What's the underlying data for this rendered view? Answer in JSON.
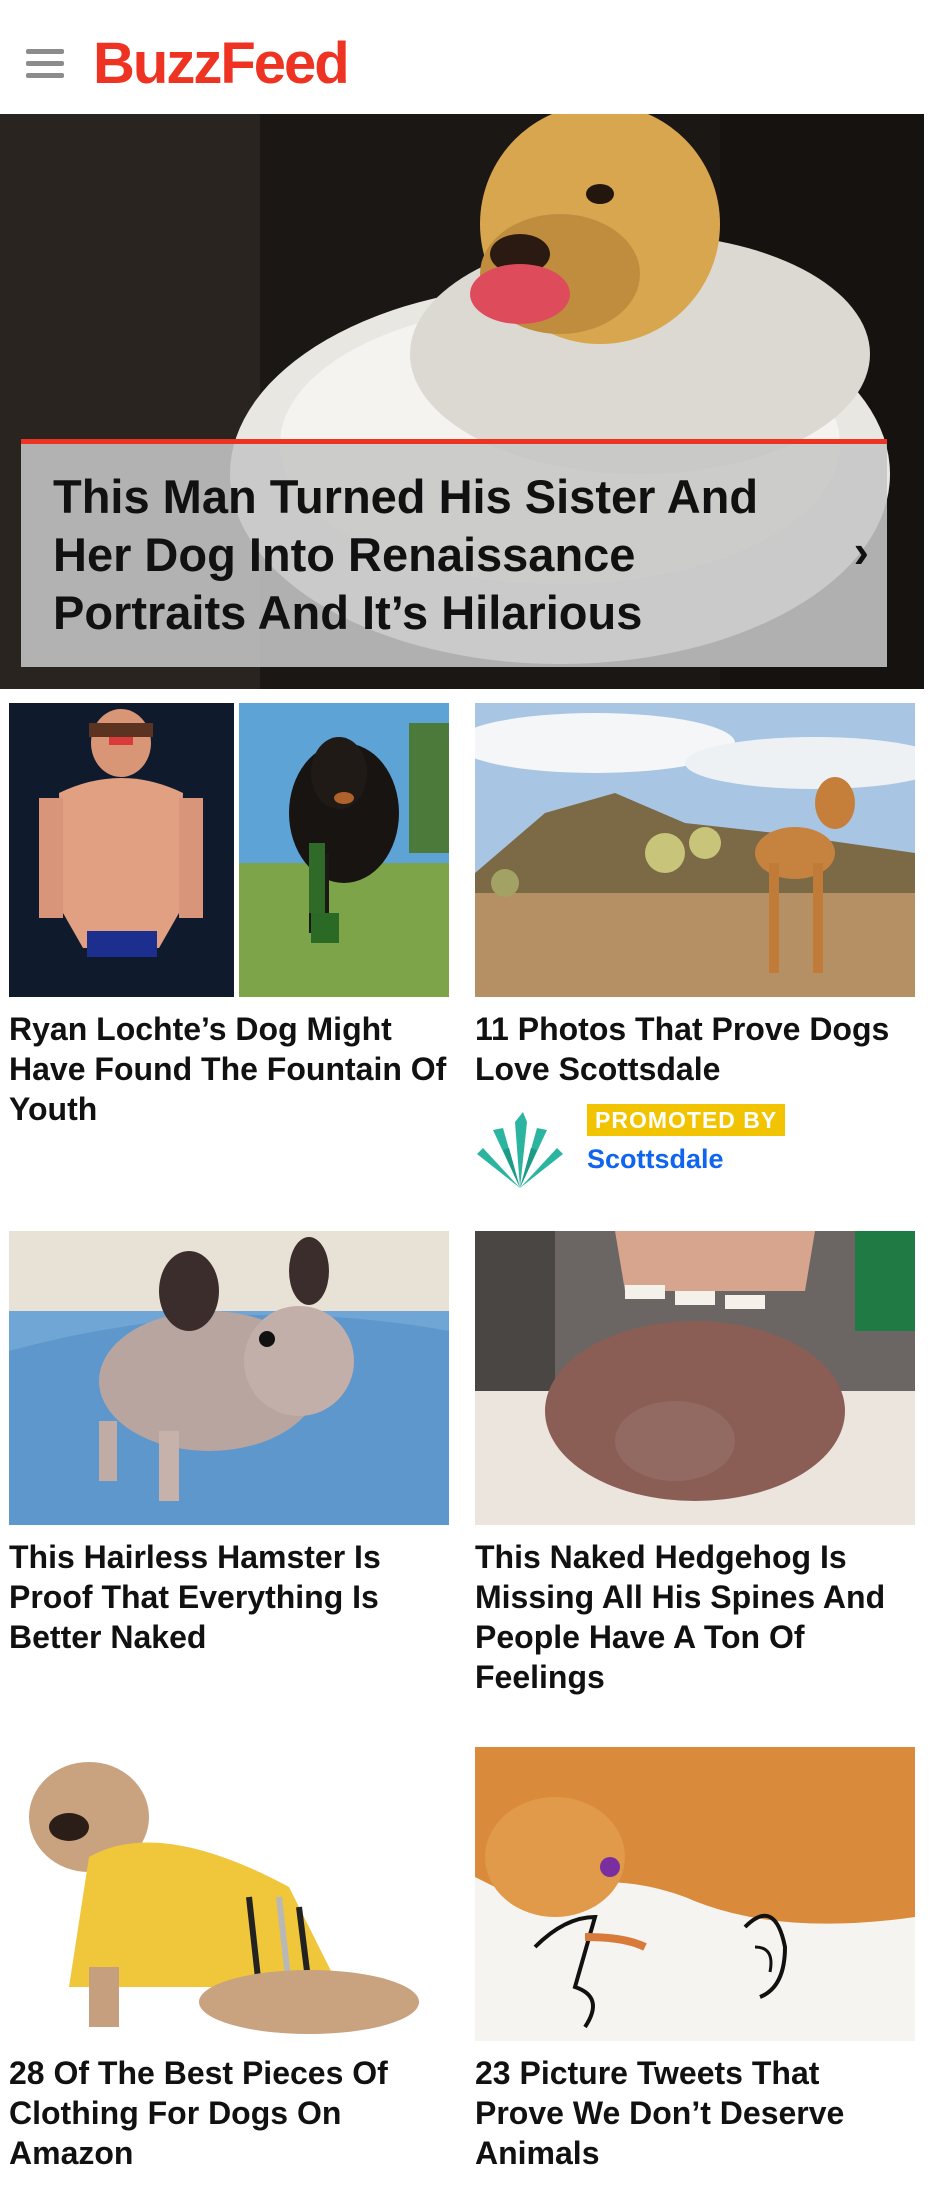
{
  "header": {
    "logo_text": "BuzzFeed",
    "menu_icon": "hamburger-menu-icon",
    "brand_color": "#ee3322"
  },
  "hero": {
    "title": "This Man Turned His Sister And Her Dog Into Renaissance Portraits And It’s Hilarious",
    "chevron": "›",
    "accent_color": "#ee3322"
  },
  "cards": [
    {
      "title": "Ryan Lochte’s Dog Might Have Found The Fountain Of Youth"
    },
    {
      "title": "11 Photos That Prove Dogs Love Scottsdale"
    },
    {
      "title": "This Hairless Hamster Is Proof That Everything Is Better Naked"
    },
    {
      "title": "This Naked Hedgehog Is Missing All His Spines And People Have A Ton Of Feelings"
    },
    {
      "title": "28 Of The Best Pieces Of Clothing For Dogs On Amazon"
    },
    {
      "title": "23 Picture Tweets That Prove We Don’t Deserve Animals"
    }
  ],
  "promo": {
    "badge": "PROMOTED BY",
    "name": "Scottsdale",
    "badge_color": "#f2c400",
    "name_color": "#0f65ef"
  }
}
